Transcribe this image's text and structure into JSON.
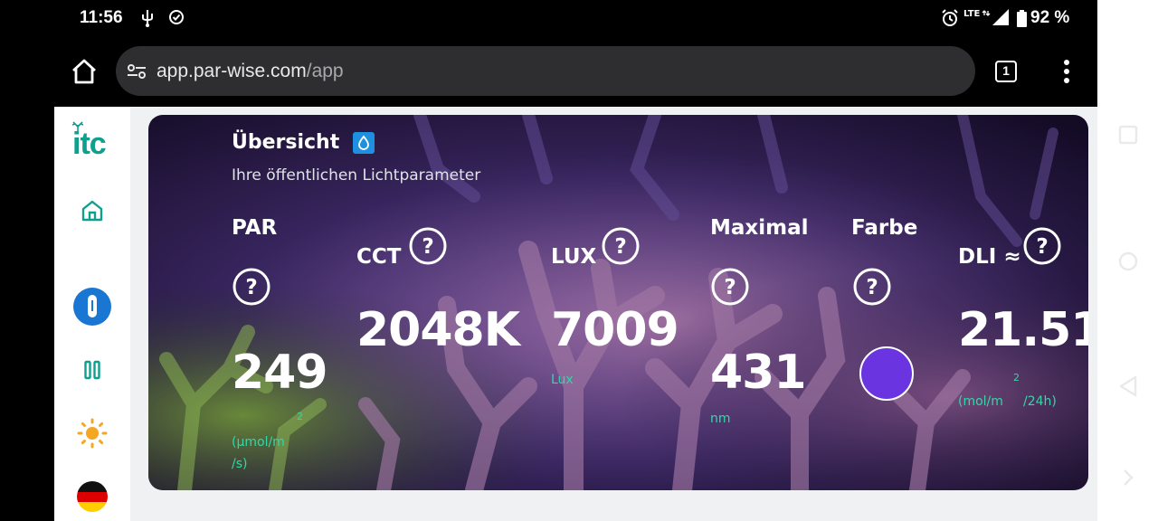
{
  "status_bar": {
    "time": "11:56",
    "network": "LTE",
    "battery": "92 %"
  },
  "browser": {
    "url_host": "app.par-wise.com",
    "url_path": "/app",
    "tab_count": "1"
  },
  "sidebar": {
    "logo": "itc"
  },
  "overview": {
    "title": "Übersicht",
    "subtitle": "Ihre öffentlichen Lichtparameter",
    "metrics": {
      "par": {
        "label": "PAR",
        "value": "249",
        "unit_line1": "(µmol/m",
        "unit_sup": "2",
        "unit_line2": "/s)"
      },
      "cct": {
        "label": "CCT",
        "value": "2048K"
      },
      "lux": {
        "label": "LUX",
        "value": "7009",
        "unit": "Lux"
      },
      "maximal": {
        "label": "Maximal",
        "value": "431",
        "unit": "nm"
      },
      "farbe": {
        "label": "Farbe",
        "color": "#6a35e0"
      },
      "dli": {
        "label": "DLI ≈",
        "value": "21.51",
        "unit_a": "(mol/m",
        "unit_sup": "2",
        "unit_b": "/24h)"
      }
    }
  },
  "colors": {
    "accent": "#0e9f8f",
    "sidebar_blue": "#1976d2",
    "sun": "#f5a623"
  }
}
